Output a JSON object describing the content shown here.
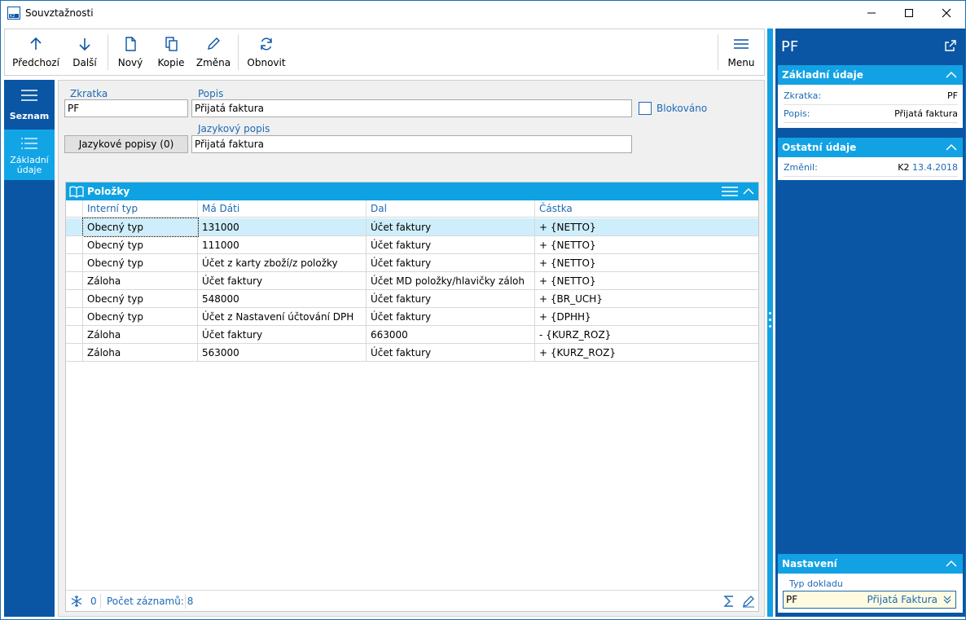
{
  "window": {
    "title": "Souvztažnosti",
    "app_icon": "k2-app-icon"
  },
  "toolbar": {
    "prev_label": "Předchozí",
    "next_label": "Další",
    "new_label": "Nový",
    "copy_label": "Kopie",
    "edit_label": "Změna",
    "refresh_label": "Obnovit",
    "menu_label": "Menu"
  },
  "leftnav": {
    "list_label": "Seznam",
    "basic_label_1": "Základní",
    "basic_label_2": "údaje"
  },
  "form": {
    "code_label": "Zkratka",
    "code_value": "PF",
    "desc_label": "Popis",
    "desc_value": "Přijatá faktura",
    "blocked_label": "Blokováno",
    "lang_button": "Jazykové popisy (0)",
    "lang_desc_label": "Jazykový popis",
    "lang_desc_value": "Přijatá faktura"
  },
  "items": {
    "title": "Položky",
    "columns": [
      "Interní typ",
      "Má Dáti",
      "Dal",
      "Částka"
    ],
    "rows": [
      [
        "Obecný typ",
        "131000",
        "Účet faktury",
        "+ {NETTO}"
      ],
      [
        "Obecný typ",
        "111000",
        "Účet faktury",
        "+ {NETTO}"
      ],
      [
        "Obecný typ",
        "Účet z karty zboží/z položky",
        "Účet faktury",
        "+ {NETTO}"
      ],
      [
        "Záloha",
        "Účet faktury",
        "Účet MD položky/hlavičky záloh",
        "+ {NETTO}"
      ],
      [
        "Obecný typ",
        "548000",
        "Účet faktury",
        "+ {BR_UCH}"
      ],
      [
        "Obecný typ",
        "Účet z Nastavení účtování DPH",
        "Účet faktury",
        "+ {DPHH}"
      ],
      [
        "Záloha",
        "Účet faktury",
        "663000",
        "- {KURZ_ROZ}"
      ],
      [
        "Záloha",
        "563000",
        "Účet faktury",
        "+ {KURZ_ROZ}"
      ]
    ],
    "selected_row": 0,
    "filter_count": "0",
    "record_count": "Počet záznamů: 8"
  },
  "right": {
    "title": "PF",
    "basic_title": "Základní údaje",
    "code_key": "Zkratka:",
    "code_val": "PF",
    "desc_key": "Popis:",
    "desc_val": "Přijatá faktura",
    "other_title": "Ostatní údaje",
    "changed_key": "Změnil:",
    "changed_user": "K2",
    "changed_date": "13.4.2018",
    "settings_title": "Nastavení",
    "doctype_label": "Typ dokladu",
    "doctype_code": "PF",
    "doctype_name": "Přijatá Faktura"
  },
  "colors": {
    "nav_dark": "#0a56a4",
    "accent": "#12a2e4",
    "label_blue": "#1e69b4",
    "selected_row": "#cfeefb"
  }
}
